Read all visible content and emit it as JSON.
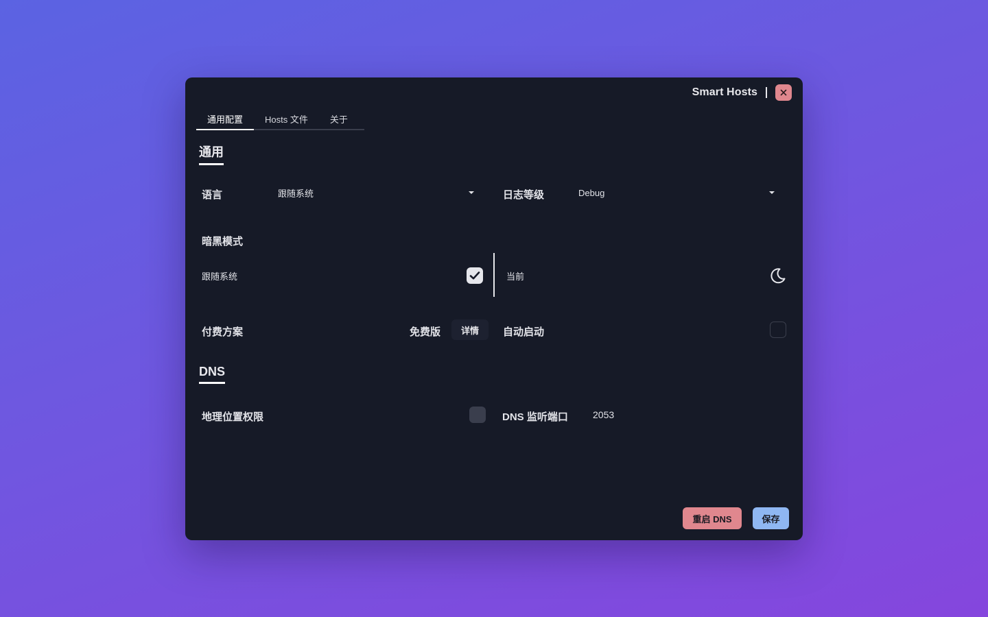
{
  "window": {
    "app_title": "Smart Hosts",
    "close_icon": "close-icon"
  },
  "tabs": [
    {
      "label": "通用配置",
      "active": true
    },
    {
      "label": "Hosts 文件",
      "active": false
    },
    {
      "label": "关于",
      "active": false
    }
  ],
  "general": {
    "section_title": "通用",
    "language": {
      "label": "语言",
      "value": "跟随系统"
    },
    "log_level": {
      "label": "日志等级",
      "value": "Debug"
    },
    "dark_mode": {
      "label": "暗黑模式",
      "follow_system_label": "跟随系统",
      "follow_system_checked": true,
      "current_label": "当前",
      "current_icon": "moon-icon"
    },
    "plan": {
      "label": "付费方案",
      "value": "免费版",
      "detail_button": "详情"
    },
    "autostart": {
      "label": "自动启动",
      "checked": false
    }
  },
  "dns": {
    "section_title": "DNS",
    "geo_permission": {
      "label": "地理位置权限",
      "checked": false
    },
    "listen_port": {
      "label": "DNS 监听端口",
      "value": "2053"
    }
  },
  "footer": {
    "restart_dns": "重启 DNS",
    "save": "保存"
  },
  "colors": {
    "window_bg": "#161a27",
    "danger": "#e0878e",
    "primary": "#8fb7f2",
    "gradient_start": "#5b63e2",
    "gradient_end": "#8546dd"
  }
}
